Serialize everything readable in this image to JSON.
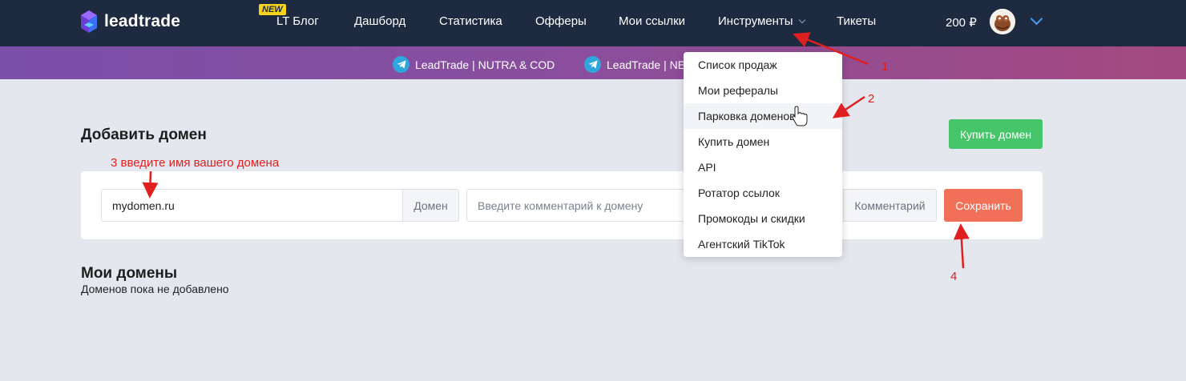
{
  "brand": {
    "name": "leadtrade"
  },
  "nav": {
    "badge": "NEW",
    "items": [
      "LT Блог",
      "Дашборд",
      "Статистика",
      "Офферы",
      "Мои ссылки",
      "Инструменты",
      "Тикеты"
    ],
    "balance": "200 ₽"
  },
  "telegram": {
    "links": [
      "LeadTrade | NUTRA & COD",
      "LeadTrade | NE"
    ]
  },
  "add_domain": {
    "title": "Добавить домен",
    "buy_button": "Купить домен",
    "domain_value": "mydomen.ru",
    "domain_addon": "Домен",
    "comment_placeholder": "Введите комментарий к домену",
    "comment_addon": "Комментарий",
    "save_button": "Сохранить"
  },
  "my_domains": {
    "title": "Мои домены",
    "empty": "Доменов пока не добавлено"
  },
  "dropdown": {
    "items": [
      "Список продаж",
      "Мои рефералы",
      "Парковка доменов",
      "Купить домен",
      "API",
      "Ротатор ссылок",
      "Промокоды и скидки",
      "Агентский TikTok"
    ],
    "hovered_index": 2
  },
  "annotations": {
    "step1": "1",
    "step2": "2",
    "step3": "3 введите имя вашего домена",
    "step4": "4",
    "color": "#e02020"
  },
  "colors": {
    "navbar": "#1d2a3f",
    "accent_green": "#47c56a",
    "accent_orange": "#f07158",
    "badge": "#f8d31c"
  }
}
